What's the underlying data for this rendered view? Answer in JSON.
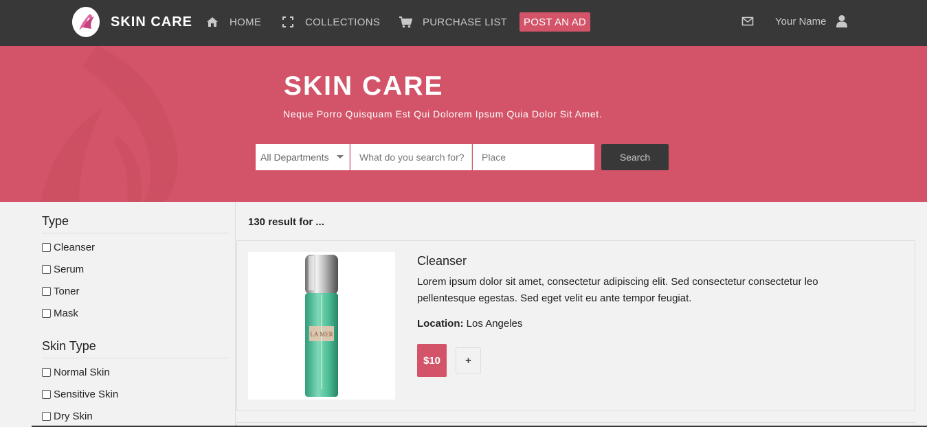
{
  "nav": {
    "brand": "SKIN CARE",
    "home": "HOME",
    "collections": "COLLECTIONS",
    "purchase_list": "PURCHASE LIST",
    "post_ad": "POST AN AD",
    "user_name": "Your Name"
  },
  "hero": {
    "title": "SKIN CARE",
    "subtitle": "Neque Porro Quisquam Est Qui Dolorem Ipsum Quia Dolor Sit Amet.",
    "department": "All Departments",
    "query_placeholder": "What do you search for?",
    "place_placeholder": "Place",
    "search_label": "Search"
  },
  "filters": [
    {
      "title": "Type",
      "options": [
        "Cleanser",
        "Serum",
        "Toner",
        "Mask"
      ]
    },
    {
      "title": "Skin Type",
      "options": [
        "Normal Skin",
        "Sensitive Skin",
        "Dry Skin"
      ]
    }
  ],
  "results": {
    "count_text": "130 result for ..."
  },
  "products": [
    {
      "title": "Cleanser",
      "description": "Lorem ipsum dolor sit amet, consectetur adipiscing elit. Sed consectetur consectetur leo pellentesque egestas. Sed eget velit eu ante tempor feugiat.",
      "location_label": "Location:",
      "location": "Los Angeles",
      "price": "$10",
      "add_label": "+",
      "brand_on_bottle": "LA MER"
    }
  ],
  "colors": {
    "accent": "#d35468",
    "nav_bg": "#383838",
    "page_bg": "#f2f2f2"
  }
}
